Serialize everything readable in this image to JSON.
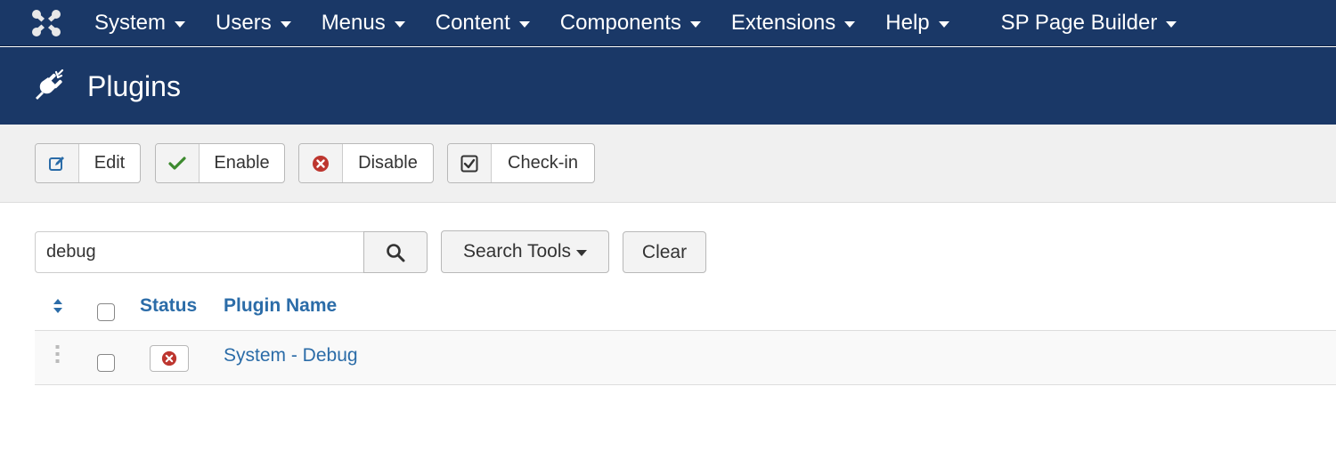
{
  "topbar": {
    "logo_icon": "joomla-logo-icon",
    "menu": [
      {
        "label": "System"
      },
      {
        "label": "Users"
      },
      {
        "label": "Menus"
      },
      {
        "label": "Content"
      },
      {
        "label": "Components"
      },
      {
        "label": "Extensions"
      },
      {
        "label": "Help"
      },
      {
        "label": "SP Page Builder"
      }
    ]
  },
  "header": {
    "icon": "plug-icon",
    "title": "Plugins"
  },
  "toolbar": {
    "edit_label": "Edit",
    "enable_label": "Enable",
    "disable_label": "Disable",
    "checkin_label": "Check-in"
  },
  "filters": {
    "search_value": "debug",
    "search_tools_label": "Search Tools",
    "clear_label": "Clear"
  },
  "table": {
    "columns": {
      "status": "Status",
      "plugin_name": "Plugin Name"
    },
    "rows": [
      {
        "status": "disabled",
        "name": "System - Debug"
      }
    ]
  },
  "colors": {
    "navbar_bg": "#1a3867",
    "link": "#2b6ca8",
    "enable_green": "#3c8a2e",
    "disable_red": "#bd362f"
  }
}
